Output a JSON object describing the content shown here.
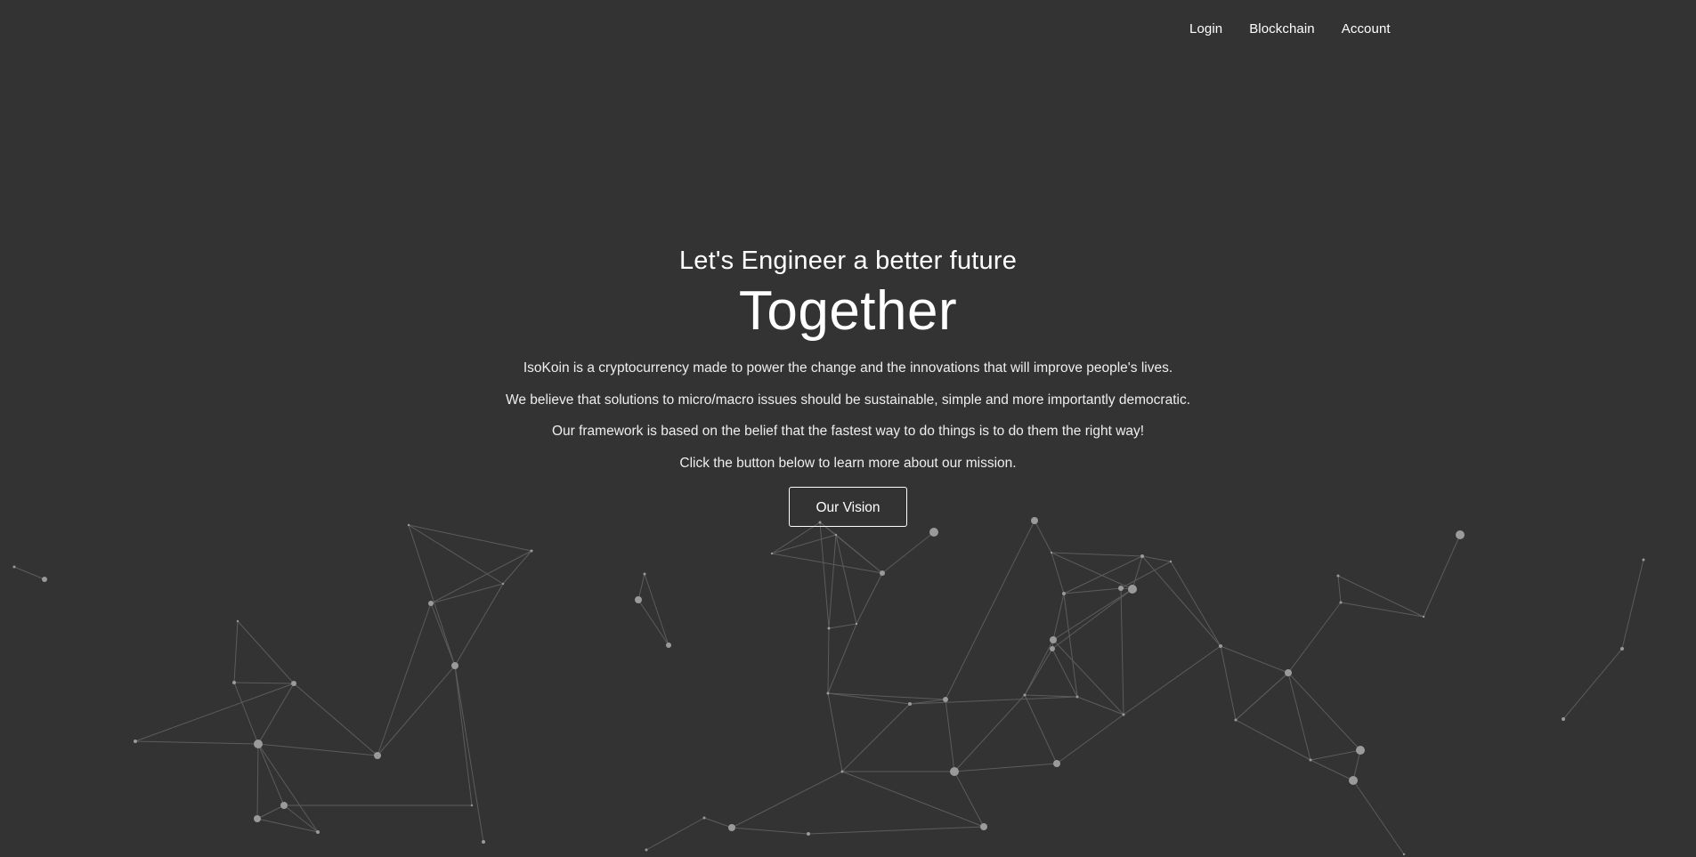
{
  "nav": {
    "items": [
      {
        "label": "Login"
      },
      {
        "label": "Blockchain"
      },
      {
        "label": "Account"
      }
    ]
  },
  "hero": {
    "tagline": "Let's Engineer a better future",
    "headline": "Together",
    "paragraphs": [
      "IsoKoin is a cryptocurrency made to power the change and the innovations that will improve people's lives.",
      "We believe that solutions to micro/macro issues should be sustainable, simple and more importantly democratic.",
      "Our framework is based on the belief that the fastest way to do things is to do them the right way!",
      "Click the button below to learn more about our mission."
    ],
    "cta_label": "Our Vision"
  },
  "colors": {
    "background": "#333333",
    "text": "#ffffff",
    "network_node": "#9a9a9a",
    "network_line": "#5c5c5c"
  }
}
